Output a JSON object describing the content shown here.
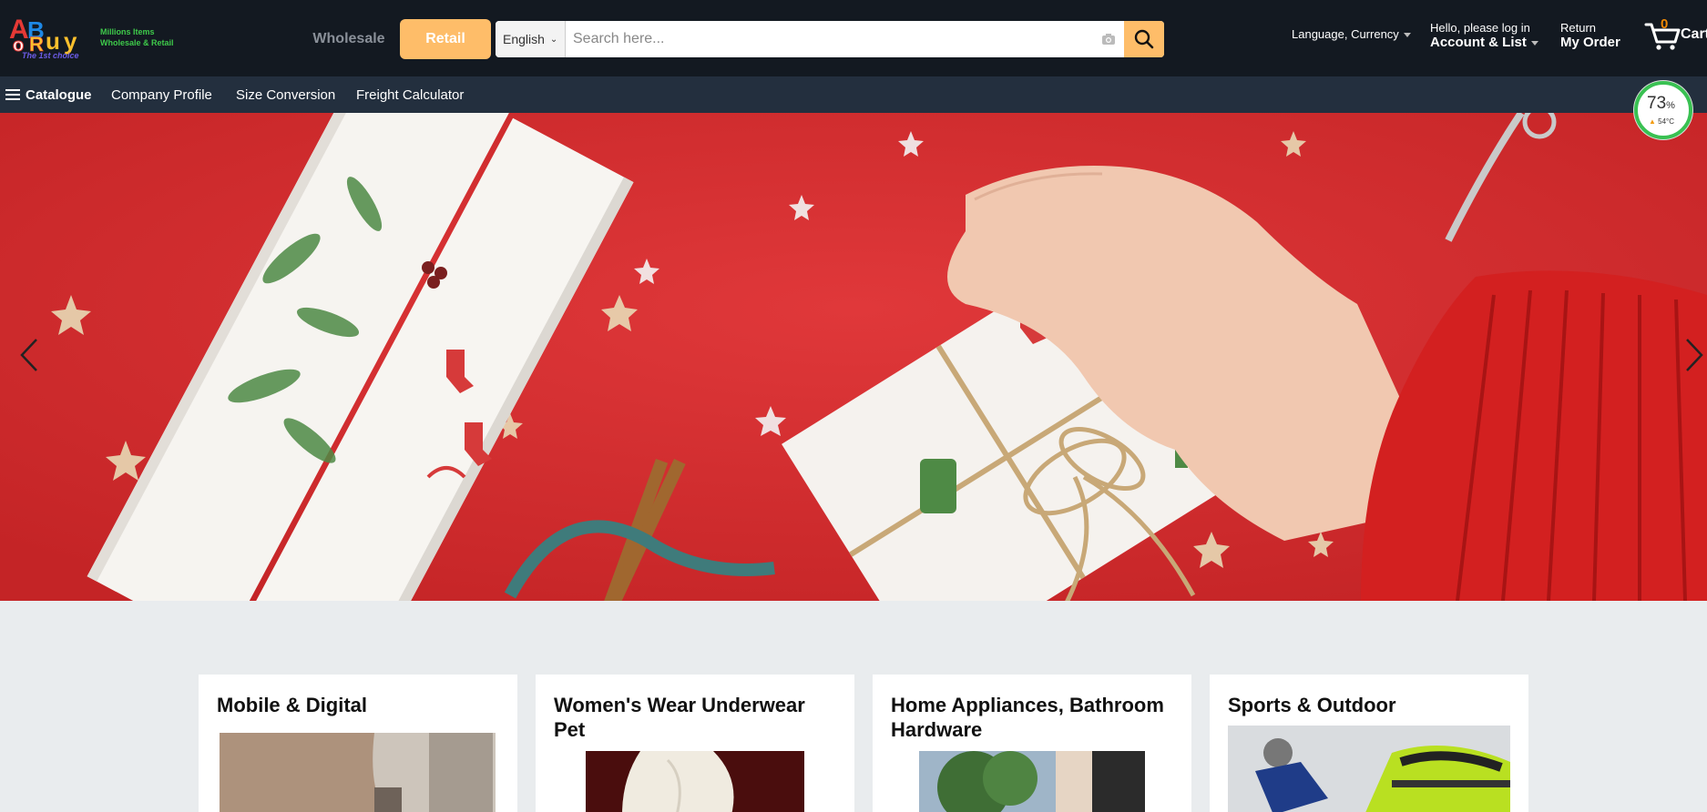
{
  "brand": {
    "logo_text": "ABuy",
    "tagline_1": "Millions Items",
    "tagline_2": "Wholesale & Retail",
    "subtitle": "The 1st choice"
  },
  "header": {
    "mode_wholesale": "Wholesale",
    "mode_retail": "Retail",
    "language_select": "English",
    "search_placeholder": "Search here...",
    "language_currency": "Language, Currency",
    "account_line1": "Hello, please log in",
    "account_line2": "Account & List",
    "return_line1": "Return",
    "return_line2": "My Order",
    "cart_count": "0",
    "cart_label": "Cart"
  },
  "nav": {
    "catalogue": "Catalogue",
    "items": [
      "Company Profile",
      "Size Conversion",
      "Freight Calculator"
    ]
  },
  "gauge": {
    "percent": "73",
    "percent_unit": "%",
    "temperature": "54°C"
  },
  "categories": [
    {
      "title": "Mobile & Digital"
    },
    {
      "title": "Women's Wear Underwear Pet"
    },
    {
      "title": "Home Appliances, Bathroom Hardware"
    },
    {
      "title": "Sports & Outdoor"
    }
  ],
  "colors": {
    "header_bg": "#131921",
    "nav_bg": "#232f3e",
    "accent": "#febd69",
    "cart_count": "#f08804",
    "gauge_ring": "#39c152",
    "banner_bg": "#d42a2c",
    "page_bg": "#e9ecee"
  },
  "icons": [
    "hamburger-icon",
    "camera-icon",
    "search-icon",
    "cart-icon",
    "chevron-left-icon",
    "chevron-right-icon",
    "caret-down-icon"
  ]
}
